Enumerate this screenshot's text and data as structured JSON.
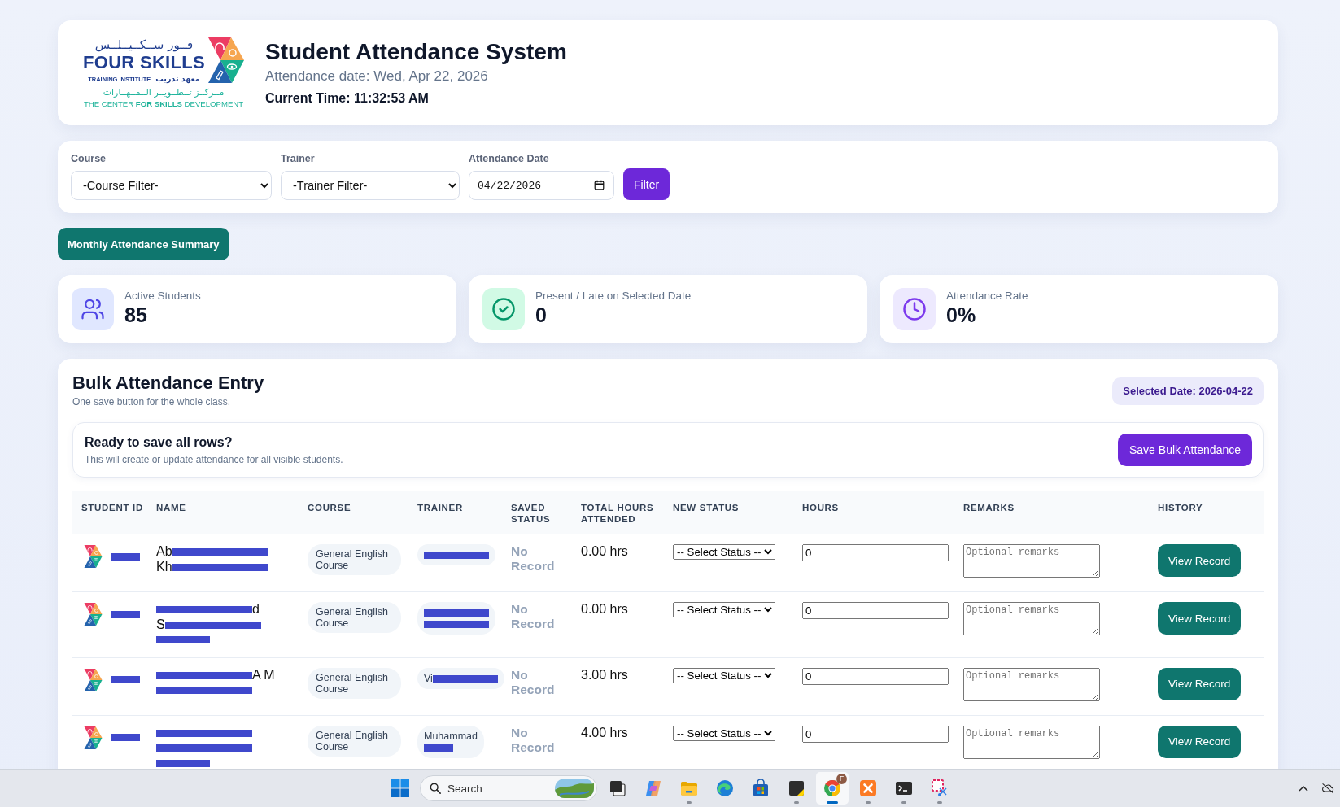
{
  "header": {
    "logo": {
      "arabic_name": "فــور ســكــيــلــس",
      "name": "FOUR SKILLS",
      "institute": "TRAINING INSTITUTE",
      "institute_arabic": "معهد تدريب",
      "arabic_tagline": "مــركــز تــطــويــر الــمــهــارات",
      "tagline": "THE CENTER **FOR** **SKILLS** DEVELOPMENT"
    },
    "title": "Student Attendance System",
    "attendance_date": "Attendance date: Wed, Apr 22, 2026",
    "current_time": "Current Time: 11:32:53 AM"
  },
  "filters": {
    "fields": [
      {
        "kind": "select",
        "label": "Course",
        "value": "-Course Filter-"
      },
      {
        "kind": "select",
        "label": "Trainer",
        "value": "-Trainer Filter-"
      },
      {
        "kind": "date",
        "label": "Attendance Date",
        "value": "04/22/2026"
      }
    ],
    "button": "Filter"
  },
  "summary_button": "Monthly Attendance Summary",
  "stats": [
    {
      "kind": "students",
      "label": "Active Students",
      "value": "85"
    },
    {
      "kind": "present",
      "label": "Present / Late on Selected Date",
      "value": "0"
    },
    {
      "kind": "rate",
      "label": "Attendance Rate",
      "value": "0%"
    }
  ],
  "bulk": {
    "title": "Bulk Attendance Entry",
    "subtitle": "One save button for the whole class.",
    "selected_date": "Selected Date: 2026-04-22",
    "save_panel": {
      "title": "Ready to save all rows?",
      "text": "This will create or update attendance for all visible students.",
      "button": "Save Bulk Attendance"
    },
    "table": {
      "columns": [
        "STUDENT ID",
        "NAME",
        "COURSE",
        "TRAINER",
        "SAVED STATUS",
        "TOTAL HOURS ATTENDED",
        "NEW STATUS",
        "HOURS",
        "REMARKS",
        "HISTORY"
      ],
      "rows": [
        {
          "student_id": [
            {
              "kind": "redaction"
            }
          ],
          "name": [
            [
              {
                "kind": "text",
                "text": "Ab"
              },
              {
                "kind": "redaction"
              }
            ],
            [
              {
                "kind": "text",
                "text": "Kh"
              },
              {
                "kind": "redaction"
              }
            ]
          ],
          "course": "General English Course",
          "trainer": [
            [
              {
                "kind": "redaction"
              }
            ]
          ],
          "saved_status": "No Record",
          "total_hours": "0.00 hrs",
          "new_status": "-- Select Status --",
          "hours": "0",
          "remarks": {
            "placeholder": "Optional remarks"
          },
          "history_button": "View Record"
        },
        {
          "student_id": [
            {
              "kind": "redaction"
            }
          ],
          "name": [
            [
              {
                "kind": "redaction"
              },
              {
                "kind": "text",
                "text": "d"
              }
            ],
            [
              {
                "kind": "text",
                "text": "S"
              },
              {
                "kind": "redaction"
              }
            ],
            [
              {
                "kind": "redaction"
              }
            ]
          ],
          "course": "General English Course",
          "trainer": [
            [
              {
                "kind": "redaction"
              }
            ],
            [
              {
                "kind": "redaction"
              }
            ]
          ],
          "saved_status": "No Record",
          "total_hours": "0.00 hrs",
          "new_status": "-- Select Status --",
          "hours": "0",
          "remarks": {
            "placeholder": "Optional remarks"
          },
          "history_button": "View Record"
        },
        {
          "student_id": [
            {
              "kind": "redaction"
            }
          ],
          "name": [
            [
              {
                "kind": "redaction"
              },
              {
                "kind": "text",
                "text": "A M"
              }
            ],
            [
              {
                "kind": "redaction"
              }
            ]
          ],
          "course": "General English Course",
          "trainer": [
            [
              {
                "kind": "text",
                "text": "Vi"
              },
              {
                "kind": "redaction"
              }
            ]
          ],
          "saved_status": "No Record",
          "total_hours": "3.00 hrs",
          "new_status": "-- Select Status --",
          "hours": "0",
          "remarks": {
            "placeholder": "Optional remarks"
          },
          "history_button": "View Record"
        },
        {
          "student_id": [
            {
              "kind": "redaction"
            }
          ],
          "name": [
            [
              {
                "kind": "redaction"
              }
            ],
            [
              {
                "kind": "redaction"
              }
            ],
            [
              {
                "kind": "redaction"
              }
            ]
          ],
          "course": "General English Course",
          "trainer": [
            [
              {
                "kind": "text",
                "text": "Muhammad"
              }
            ],
            [
              {
                "kind": "redaction"
              }
            ]
          ],
          "saved_status": "No Record",
          "total_hours": "4.00 hrs",
          "new_status": "-- Select Status --",
          "hours": "0",
          "remarks": {
            "placeholder": "Optional remarks"
          },
          "history_button": "View Record"
        }
      ]
    }
  },
  "taskbar": {
    "search": {
      "placeholder": "Search"
    },
    "apps": [
      {
        "kind": "stack",
        "running": false,
        "selected": false
      },
      {
        "kind": "swirl",
        "running": false,
        "selected": false
      },
      {
        "kind": "folder",
        "running": true,
        "selected": false
      },
      {
        "kind": "wave",
        "running": false,
        "selected": false
      },
      {
        "kind": "bag",
        "running": false,
        "selected": false
      },
      {
        "kind": "note",
        "running": true,
        "selected": false
      },
      {
        "kind": "ring",
        "running": true,
        "selected": true,
        "badge": "F"
      },
      {
        "kind": "tile",
        "running": true,
        "selected": false
      },
      {
        "kind": "terminal",
        "running": true,
        "selected": false
      },
      {
        "kind": "scissors",
        "running": true,
        "selected": false
      }
    ]
  }
}
